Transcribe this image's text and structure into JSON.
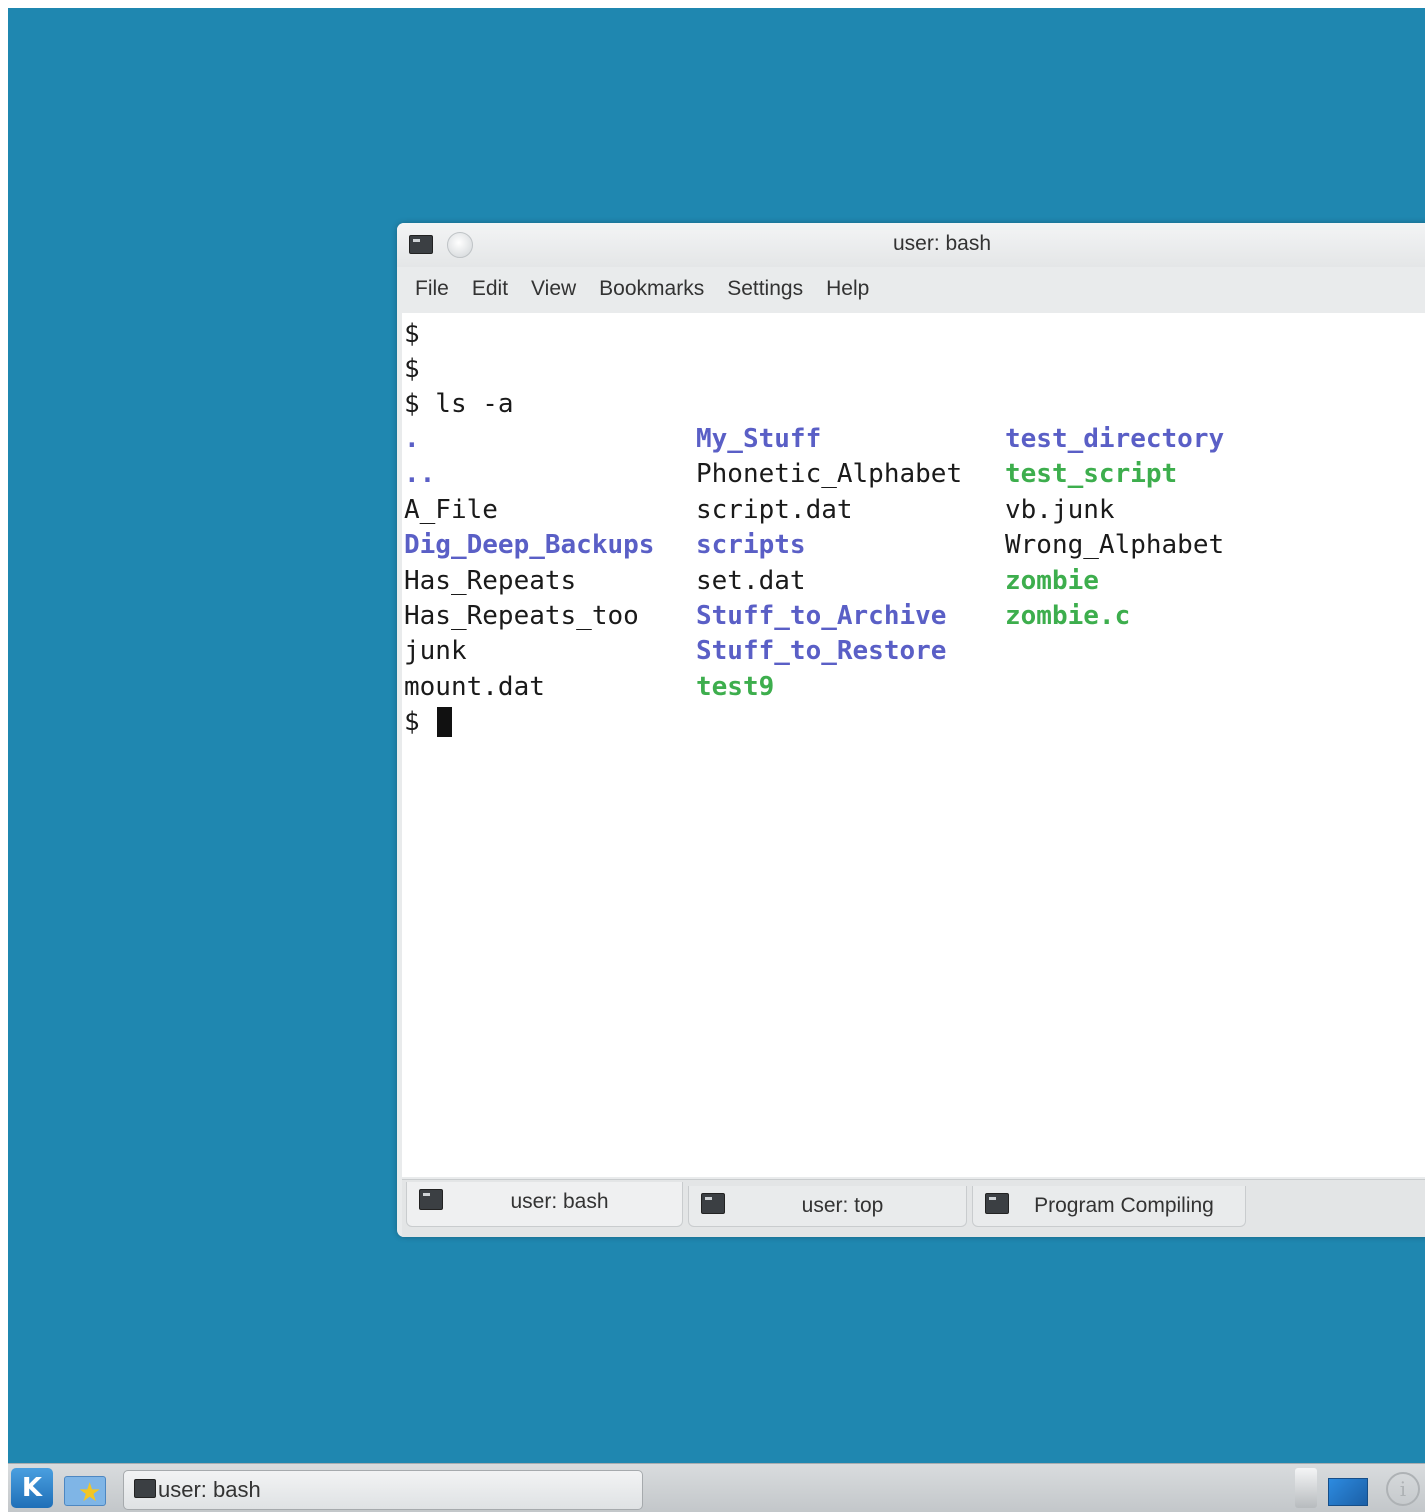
{
  "window": {
    "title": "user: bash",
    "menu": [
      "File",
      "Edit",
      "View",
      "Bookmarks",
      "Settings",
      "Help"
    ]
  },
  "terminal": {
    "lines": [
      "$",
      "$",
      "$ ls -a"
    ],
    "prompt": "$",
    "listing": [
      [
        {
          "name": ".",
          "type": "dir"
        },
        {
          "name": "..",
          "type": "dir"
        },
        {
          "name": "A_File",
          "type": "file"
        },
        {
          "name": "Dig_Deep_Backups",
          "type": "dir"
        },
        {
          "name": "Has_Repeats",
          "type": "file"
        },
        {
          "name": "Has_Repeats_too",
          "type": "file"
        },
        {
          "name": "junk",
          "type": "file"
        },
        {
          "name": "mount.dat",
          "type": "file"
        }
      ],
      [
        {
          "name": "My_Stuff",
          "type": "dir"
        },
        {
          "name": "Phonetic_Alphabet",
          "type": "file"
        },
        {
          "name": "script.dat",
          "type": "file"
        },
        {
          "name": "scripts",
          "type": "dir"
        },
        {
          "name": "set.dat",
          "type": "file"
        },
        {
          "name": "Stuff_to_Archive",
          "type": "dir"
        },
        {
          "name": "Stuff_to_Restore",
          "type": "dir"
        },
        {
          "name": "test9",
          "type": "exe"
        }
      ],
      [
        {
          "name": "test_directory",
          "type": "dir"
        },
        {
          "name": "test_script",
          "type": "exe"
        },
        {
          "name": "vb.junk",
          "type": "file"
        },
        {
          "name": "Wrong_Alphabet",
          "type": "file"
        },
        {
          "name": "zombie",
          "type": "exe"
        },
        {
          "name": "zombie.c",
          "type": "exe"
        }
      ]
    ]
  },
  "tabs": [
    {
      "label": "user: bash",
      "active": true
    },
    {
      "label": "user: top",
      "active": false
    },
    {
      "label": "Program Compiling",
      "active": false
    }
  ],
  "panel": {
    "task_label": "user: bash",
    "info_glyph": "i"
  },
  "colors": {
    "desktop": "#1f87b0",
    "directory": "#5a5fc6",
    "executable": "#3dae4d"
  },
  "icons": [
    "terminal-icon",
    "kde-menu-icon",
    "favorites-star-icon",
    "device-notifier-icon",
    "pager-icon",
    "info-icon"
  ]
}
